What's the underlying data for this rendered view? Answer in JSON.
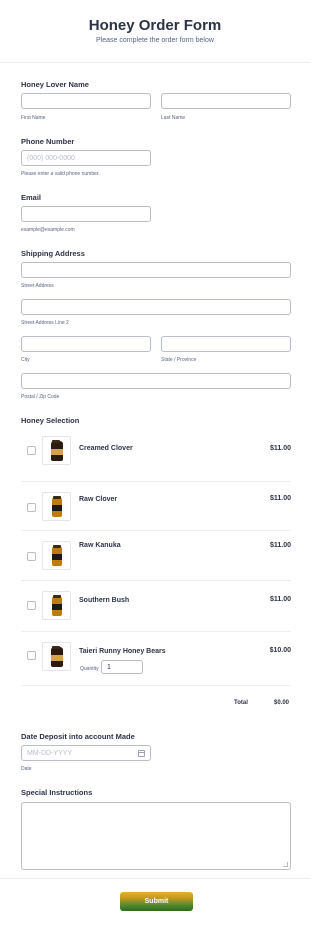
{
  "header": {
    "title": "Honey Order Form",
    "subtitle": "Please complete the order form below"
  },
  "name_field": {
    "label": "Honey Lover Name",
    "first_sublabel": "First Name",
    "last_sublabel": "Last Name",
    "first_value": "",
    "last_value": ""
  },
  "phone_field": {
    "label": "Phone Number",
    "placeholder": "(000) 000-0000",
    "sublabel": "Please enter a valid phone number."
  },
  "email_field": {
    "label": "Email",
    "value": "",
    "sublabel": "example@example.com"
  },
  "address": {
    "label": "Shipping Address",
    "street_sublabel": "Street Address",
    "street2_sublabel": "Street Address Line 2",
    "city_sublabel": "City",
    "state_sublabel": "State / Province",
    "zip_sublabel": "Postal / Zip Code"
  },
  "honey_selection": {
    "label": "Honey Selection",
    "products": [
      {
        "name": "Creamed Clover",
        "price": "$11.00",
        "icon": "honey-jar-icon"
      },
      {
        "name": "Raw Clover",
        "price": "$11.00",
        "icon": "honey-bottle-icon"
      },
      {
        "name": "Raw Kanuka",
        "price": "$11.00",
        "icon": "honey-bottle-icon"
      },
      {
        "name": "Southern Bush",
        "price": "$11.00",
        "icon": "honey-bottle-icon"
      },
      {
        "name": "Taieri Runny Honey Bears",
        "price": "$10.00",
        "icon": "honey-bear-icon",
        "quantity_label": "Quantity",
        "quantity_value": "1"
      }
    ],
    "total_label": "Total",
    "total_value": "$0.00"
  },
  "date_field": {
    "label": "Date Deposit into account Made",
    "placeholder": "MM-DD-YYYY",
    "sublabel": "Date"
  },
  "instructions": {
    "label": "Special Instructions",
    "value": ""
  },
  "submit_label": "Submit",
  "colors": {
    "text": "#2c3345",
    "sublabel": "#57647e",
    "border": "#b8bdc9",
    "submit_gold": "#e3b32a",
    "submit_green": "#2e6a1c"
  }
}
